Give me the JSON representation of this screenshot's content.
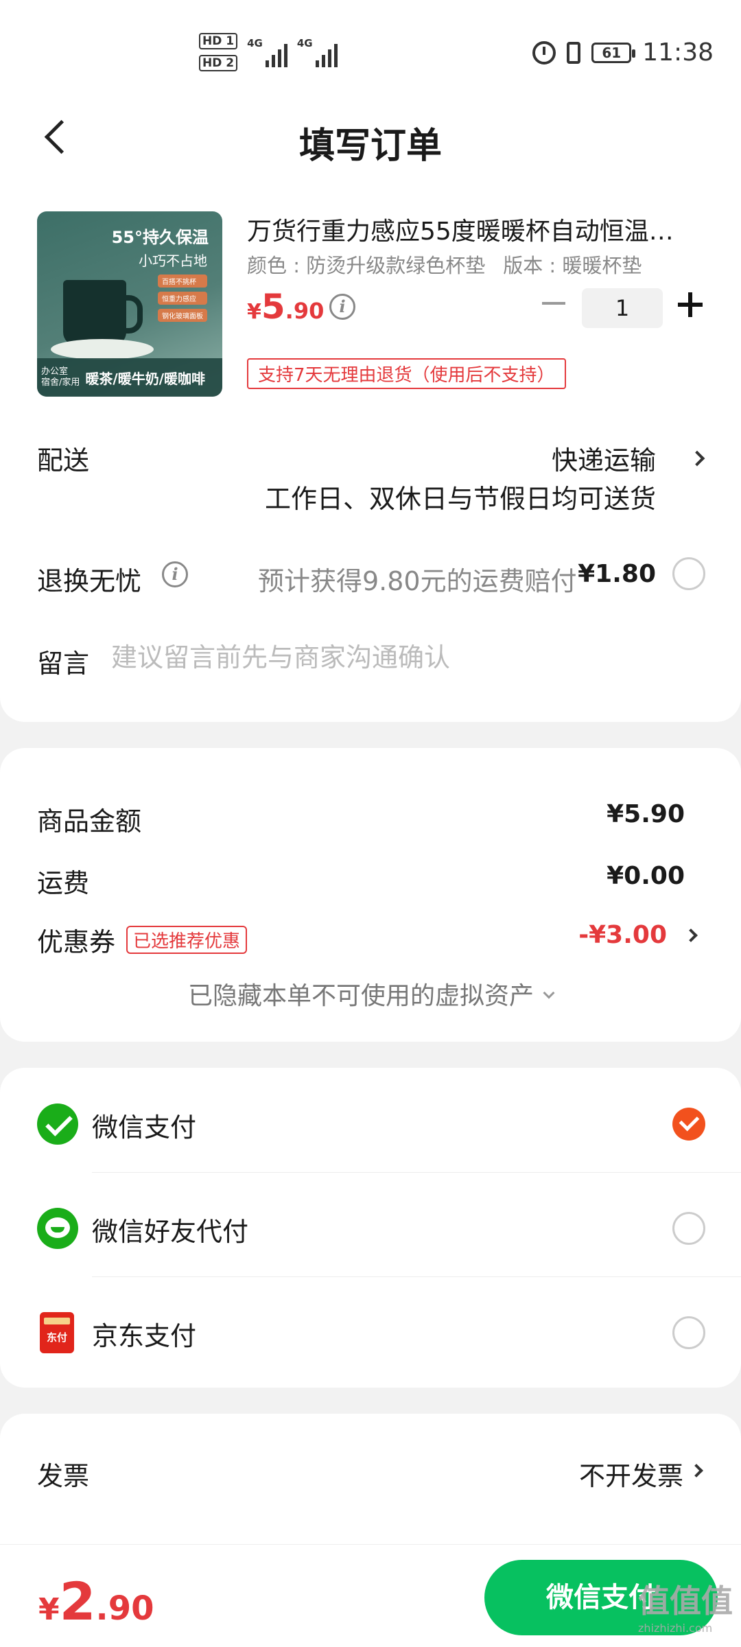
{
  "status_bar": {
    "hd1": "HD 1",
    "hd2": "HD 2",
    "net1": "4G",
    "net2": "4G",
    "battery": "61",
    "time": "11:38"
  },
  "header": {
    "title": "填写订单"
  },
  "product": {
    "image": {
      "headline": "55°持久保温",
      "sub": "小巧不占地",
      "tags": [
        "百搭不挑杯",
        "恒重力感应",
        "钢化玻璃面板"
      ],
      "bottom_small_1": "办公室",
      "bottom_small_2": "宿舍/家用",
      "bottom_big": "暖茶/暖牛奶/暖咖啡"
    },
    "title": "万货行重力感应55度暖暖杯自动恒温…",
    "spec_color": "颜色 : 防烫升级款绿色杯垫",
    "spec_version": "版本 : 暖暖杯垫",
    "price_currency": "¥",
    "price_int": "5",
    "price_dec": ".90",
    "quantity": "1",
    "return_policy": "支持7天无理由退货（使用后不支持）"
  },
  "delivery": {
    "label": "配送",
    "value": "快递运输",
    "note": "工作日、双休日与节假日均可送货"
  },
  "return_insurance": {
    "label": "退换无忧",
    "estimate": "预计获得9.80元的运费赔付",
    "price": "¥1.80"
  },
  "message": {
    "label": "留言",
    "placeholder": "建议留言前先与商家沟通确认"
  },
  "summary": {
    "goods_label": "商品金额",
    "goods_value": "¥5.90",
    "shipping_label": "运费",
    "shipping_value": "¥0.00",
    "coupon_label": "优惠券",
    "coupon_tag": "已选推荐优惠",
    "coupon_value": "-¥3.00",
    "hidden_note": "已隐藏本单不可使用的虚拟资产"
  },
  "payment": {
    "methods": [
      {
        "label": "微信支付",
        "icon": "wechat-pay-icon",
        "selected": true
      },
      {
        "label": "微信好友代付",
        "icon": "wechat-friend-pay-icon",
        "selected": false
      },
      {
        "label": "京东支付",
        "icon": "jd-pay-icon",
        "icon_text": "东付",
        "selected": false
      }
    ],
    "accent": "#f2511d"
  },
  "invoice": {
    "label": "发票",
    "value": "不开发票"
  },
  "bottom": {
    "currency": "¥",
    "total_int": "2",
    "total_dec": ".90",
    "pay_button": "微信支付",
    "watermark": "值值值",
    "watermark_url": "zhizhizhi.com",
    "button_color": "#07c160",
    "price_color": "#e4393c"
  }
}
